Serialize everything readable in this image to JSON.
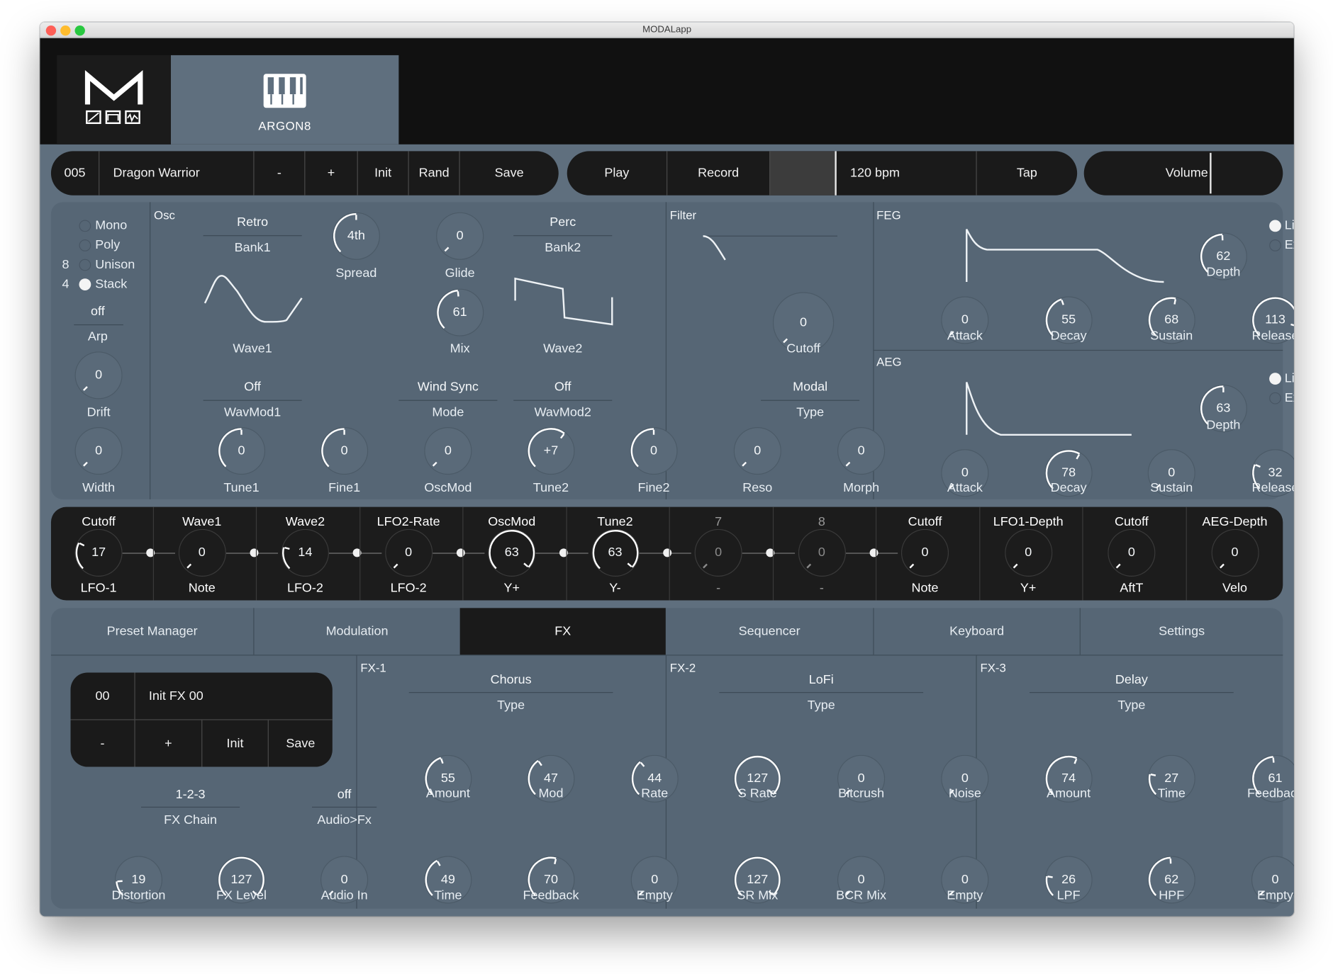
{
  "window": {
    "title": "MODALapp"
  },
  "header": {
    "product_name": "ARGON8"
  },
  "preset_bar": {
    "number": "005",
    "name": "Dragon Warrior",
    "minus": "-",
    "plus": "+",
    "init": "Init",
    "rand": "Rand",
    "save": "Save"
  },
  "transport": {
    "play": "Play",
    "record": "Record",
    "tempo": "120 bpm",
    "tap": "Tap"
  },
  "volume": {
    "label": "Volume"
  },
  "voice": {
    "modes": [
      {
        "label": "Mono",
        "count": "",
        "selected": false
      },
      {
        "label": "Poly",
        "count": "",
        "selected": false
      },
      {
        "label": "Unison",
        "count": "8",
        "selected": false
      },
      {
        "label": "Stack",
        "count": "4",
        "selected": true
      }
    ],
    "arp_value": "off",
    "arp_label": "Arp",
    "drift": {
      "label": "Drift",
      "value": "0"
    },
    "width": {
      "label": "Width",
      "value": "0"
    }
  },
  "osc": {
    "title": "Osc",
    "bank1_name": "Retro",
    "bank1_label": "Bank1",
    "bank2_name": "Perc",
    "bank2_label": "Bank2",
    "spread": {
      "label": "Spread",
      "value": "4th"
    },
    "glide": {
      "label": "Glide",
      "value": "0"
    },
    "mix": {
      "label": "Mix",
      "value": "61"
    },
    "wave1_label": "Wave1",
    "wave2_label": "Wave2",
    "wavmod1_value": "Off",
    "wavmod1_label": "WavMod1",
    "mode_value": "Wind Sync",
    "mode_label": "Mode",
    "wavmod2_value": "Off",
    "wavmod2_label": "WavMod2",
    "tune1": {
      "label": "Tune1",
      "value": "0"
    },
    "fine1": {
      "label": "Fine1",
      "value": "0"
    },
    "oscmod": {
      "label": "OscMod",
      "value": "0"
    },
    "tune2": {
      "label": "Tune2",
      "value": "+7"
    },
    "fine2": {
      "label": "Fine2",
      "value": "0"
    }
  },
  "filter": {
    "title": "Filter",
    "cutoff": {
      "label": "Cutoff",
      "value": "0"
    },
    "type_value": "Modal",
    "type_label": "Type",
    "reso": {
      "label": "Reso",
      "value": "0"
    },
    "morph": {
      "label": "Morph",
      "value": "0"
    }
  },
  "feg": {
    "title": "FEG",
    "depth": {
      "label": "Depth",
      "value": "62"
    },
    "curve": [
      {
        "label": "Lin",
        "selected": true
      },
      {
        "label": "Exp",
        "selected": false
      }
    ],
    "attack": {
      "label": "Attack",
      "value": "0"
    },
    "decay": {
      "label": "Decay",
      "value": "55"
    },
    "sustain": {
      "label": "Sustain",
      "value": "68"
    },
    "release": {
      "label": "Release",
      "value": "113"
    }
  },
  "aeg": {
    "title": "AEG",
    "depth": {
      "label": "Depth",
      "value": "63"
    },
    "curve": [
      {
        "label": "Lin",
        "selected": true
      },
      {
        "label": "Exp",
        "selected": false
      }
    ],
    "attack": {
      "label": "Attack",
      "value": "0"
    },
    "decay": {
      "label": "Decay",
      "value": "78"
    },
    "sustain": {
      "label": "Sustain",
      "value": "0"
    },
    "release": {
      "label": "Release",
      "value": "32"
    }
  },
  "mod_matrix": [
    {
      "dest": "Cutoff",
      "value": "17",
      "source": "LFO-1",
      "dim": false
    },
    {
      "dest": "Wave1",
      "value": "0",
      "source": "Note",
      "dim": false
    },
    {
      "dest": "Wave2",
      "value": "14",
      "source": "LFO-2",
      "dim": false
    },
    {
      "dest": "LFO2-Rate",
      "value": "0",
      "source": "LFO-2",
      "dim": false
    },
    {
      "dest": "OscMod",
      "value": "63",
      "source": "Y+",
      "dim": false
    },
    {
      "dest": "Tune2",
      "value": "63",
      "source": "Y-",
      "dim": false
    },
    {
      "dest": "7",
      "value": "0",
      "source": "-",
      "dim": true
    },
    {
      "dest": "8",
      "value": "0",
      "source": "-",
      "dim": true
    },
    {
      "dest": "Cutoff",
      "value": "0",
      "source": "Note",
      "dim": false
    },
    {
      "dest": "LFO1-Depth",
      "value": "0",
      "source": "Y+",
      "dim": false
    },
    {
      "dest": "Cutoff",
      "value": "0",
      "source": "AftT",
      "dim": false
    },
    {
      "dest": "AEG-Depth",
      "value": "0",
      "source": "Velo",
      "dim": false
    }
  ],
  "tabs": [
    {
      "label": "Preset Manager",
      "active": false
    },
    {
      "label": "Modulation",
      "active": false
    },
    {
      "label": "FX",
      "active": true
    },
    {
      "label": "Sequencer",
      "active": false
    },
    {
      "label": "Keyboard",
      "active": false
    },
    {
      "label": "Settings",
      "active": false
    }
  ],
  "fx_preset": {
    "number": "00",
    "name": "Init FX 00",
    "minus": "-",
    "plus": "+",
    "init": "Init",
    "save": "Save"
  },
  "fx_global": {
    "chain_value": "1-2-3",
    "chain_label": "FX Chain",
    "audio_value": "off",
    "audio_label": "Audio>Fx",
    "distortion": {
      "label": "Distortion",
      "value": "19"
    },
    "fx_level": {
      "label": "FX Level",
      "value": "127"
    },
    "audio_in": {
      "label": "Audio In",
      "value": "0"
    }
  },
  "fx1": {
    "title": "FX-1",
    "type_value": "Chorus",
    "type_label": "Type",
    "k1": {
      "label": "Amount",
      "value": "55"
    },
    "k2": {
      "label": "Mod",
      "value": "47"
    },
    "k3": {
      "label": "Rate",
      "value": "44"
    },
    "k4": {
      "label": "Time",
      "value": "49"
    },
    "k5": {
      "label": "Feedback",
      "value": "70"
    },
    "k6": {
      "label": "Empty",
      "value": "0"
    }
  },
  "fx2": {
    "title": "FX-2",
    "type_value": "LoFi",
    "type_label": "Type",
    "k1": {
      "label": "S Rate",
      "value": "127"
    },
    "k2": {
      "label": "Bitcrush",
      "value": "0"
    },
    "k3": {
      "label": "Noise",
      "value": "0"
    },
    "k4": {
      "label": "SR Mix",
      "value": "127"
    },
    "k5": {
      "label": "BCR Mix",
      "value": "0"
    },
    "k6": {
      "label": "Empty",
      "value": "0"
    }
  },
  "fx3": {
    "title": "FX-3",
    "type_value": "Delay",
    "type_label": "Type",
    "k1": {
      "label": "Amount",
      "value": "74"
    },
    "k2": {
      "label": "Time",
      "value": "27"
    },
    "k3": {
      "label": "Feedback",
      "value": "61"
    },
    "k4": {
      "label": "LPF",
      "value": "26"
    },
    "k5": {
      "label": "HPF",
      "value": "62"
    },
    "k6": {
      "label": "Empty",
      "value": "0"
    }
  },
  "colors": {
    "window_bg": "#5f6f7e",
    "panel": "#566675",
    "dark": "#1a1a1a",
    "text": "#ffffff"
  }
}
